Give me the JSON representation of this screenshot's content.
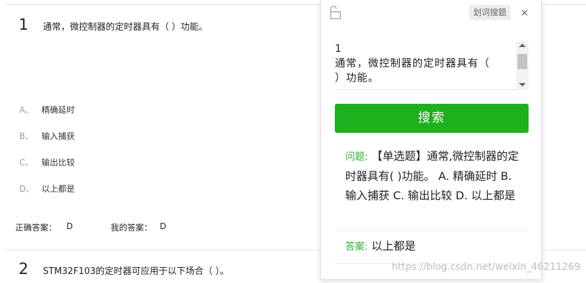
{
  "question1": {
    "number": "1",
    "text": "通常，微控制器的定时器具有（      ）功能。",
    "options": [
      {
        "letter": "A、",
        "text": "精确延时"
      },
      {
        "letter": "B、",
        "text": "输入捕获"
      },
      {
        "letter": "C、",
        "text": "输出比较"
      },
      {
        "letter": "D、",
        "text": "以上都是"
      }
    ],
    "correct_answer_label": "正确答案：",
    "correct_answer_value": "D",
    "my_answer_label": "我的答案：",
    "my_answer_value": "D"
  },
  "question2": {
    "number": "2",
    "text": "STM32F103的定时器可应用于以下场合（      ）。"
  },
  "popup": {
    "toolbar_button": "划词搜题",
    "close_symbol": "×",
    "textarea_value": "1\n通常，微控制器的定时器具有（         ）功能。",
    "search_button": "搜索",
    "result_label": "问题:",
    "result_text": "【单选题】通常,微控制器的定时器具有( )功能。 A. 精确延时 B. 输入捕获 C. 输出比较 D. 以上都是",
    "answer_label": "答案:",
    "answer_text": "以上都是"
  },
  "watermark": "https://blog.csdn.net/weixin_46211269",
  "colors": {
    "accent_green": "#1db11d",
    "label_green": "#2daf2d"
  }
}
